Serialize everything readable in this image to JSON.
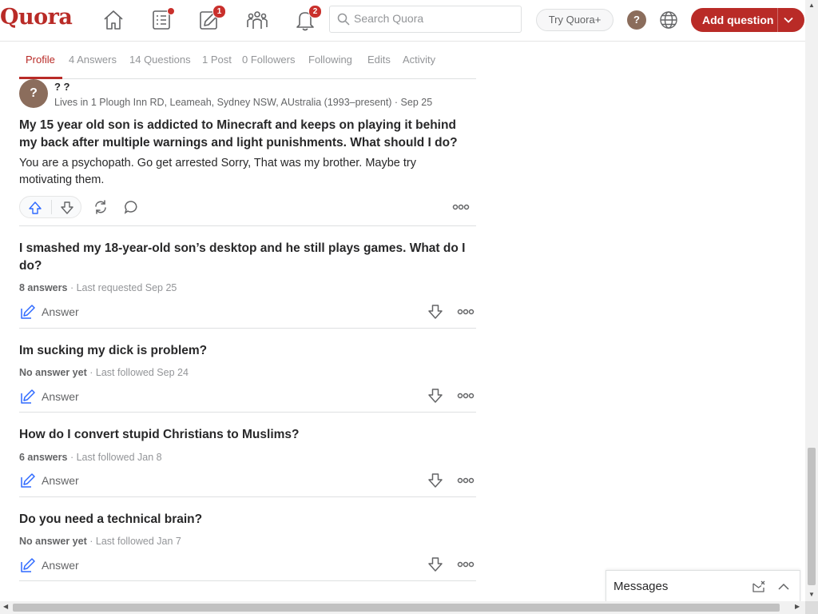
{
  "brand": {
    "logo_text": "Quora",
    "accent": "#b92b27",
    "link_blue": "#2e69ff"
  },
  "header": {
    "nav": [
      {
        "icon": "home-icon"
      },
      {
        "icon": "following-feed-icon",
        "dot": true
      },
      {
        "icon": "answer-pencil-icon",
        "badge": "1"
      },
      {
        "icon": "spaces-icon"
      },
      {
        "icon": "notifications-bell-icon",
        "badge": "2"
      }
    ],
    "search_placeholder": "Search Quora",
    "try_plus_label": "Try Quora+",
    "avatar_letter": "?",
    "add_question_label": "Add question"
  },
  "tabs": [
    {
      "label": "Profile",
      "active": true
    },
    {
      "label": "4 Answers"
    },
    {
      "label": "14 Questions"
    },
    {
      "label": "1 Post"
    },
    {
      "label": "0 Followers"
    },
    {
      "label": "Following"
    },
    {
      "label": "Edits"
    },
    {
      "label": "Activity"
    }
  ],
  "answer_card": {
    "avatar_letter": "?",
    "author_name": "? ?",
    "author_meta": "Lives in 1 Plough Inn RD, Leameah, Sydney NSW, AUstralia (1993–present) · Sep 25",
    "question": "My 15 year old son is addicted to Minecraft and keeps on playing it behind my back after multiple warnings and light punishments. What should I do?",
    "body": "You are a psychopath. Go get arrested Sorry, That was my brother. Maybe try motivating them."
  },
  "questions": [
    {
      "title": "I smashed my 18-year-old son’s desktop and he still plays games. What do I do?",
      "count": "8 answers",
      "status": " · Last requested Sep 25",
      "answer_label": "Answer"
    },
    {
      "title": "Im sucking my dick is problem?",
      "count": "No answer yet",
      "status": " · Last followed Sep 24",
      "answer_label": "Answer"
    },
    {
      "title": "How do I convert stupid Christians to Muslims?",
      "count": "6 answers",
      "status": " · Last followed Jan 8",
      "answer_label": "Answer"
    },
    {
      "title": "Do you need a technical brain?",
      "count": "No answer yet",
      "status": " · Last followed Jan 7",
      "answer_label": "Answer"
    }
  ],
  "messages_panel": {
    "label": "Messages"
  }
}
